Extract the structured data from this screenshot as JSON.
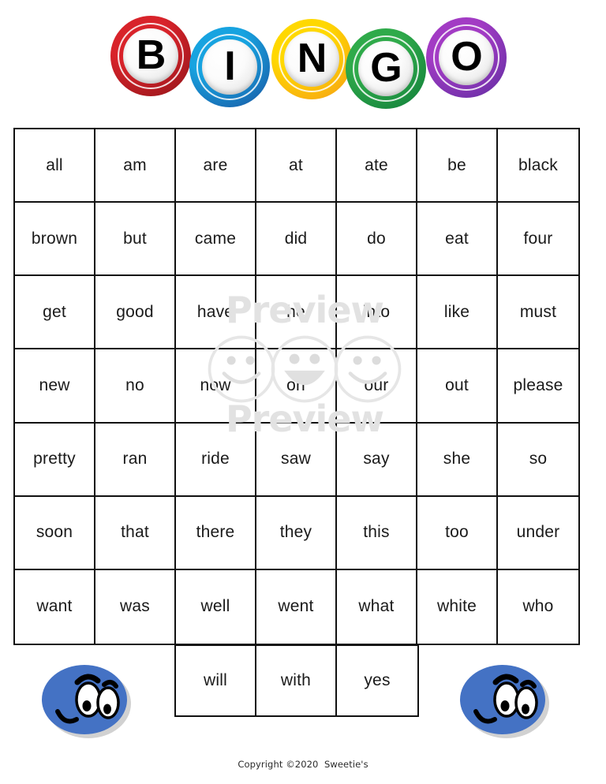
{
  "page": {
    "background_color": "#ffffff",
    "copyright": "Copyright ©2020  Sweetie's"
  },
  "header": {
    "title": "BINGO",
    "balls": [
      {
        "letter": "B",
        "color": "#d8232a",
        "dark": "#8c1419",
        "name": "bingo-ball-b"
      },
      {
        "letter": "I",
        "color": "#17a3e0",
        "dark": "#1a4f9c",
        "name": "bingo-ball-i"
      },
      {
        "letter": "N",
        "color": "#ffd800",
        "dark": "#f59a18",
        "name": "bingo-ball-n"
      },
      {
        "letter": "G",
        "color": "#2faa4a",
        "dark": "#0f7a3a",
        "name": "bingo-ball-g"
      },
      {
        "letter": "O",
        "color": "#a23bc4",
        "dark": "#5b2d9e",
        "name": "bingo-ball-o"
      }
    ]
  },
  "grid": {
    "columns": 7,
    "rows": 7,
    "words": [
      [
        "all",
        "am",
        "are",
        "at",
        "ate",
        "be",
        "black"
      ],
      [
        "brown",
        "but",
        "came",
        "did",
        "do",
        "eat",
        "four"
      ],
      [
        "get",
        "good",
        "have",
        "he",
        "into",
        "like",
        "must"
      ],
      [
        "new",
        "no",
        "now",
        "on",
        "our",
        "out",
        "please"
      ],
      [
        "pretty",
        "ran",
        "ride",
        "saw",
        "say",
        "she",
        "so"
      ],
      [
        "soon",
        "that",
        "there",
        "they",
        "this",
        "too",
        "under"
      ],
      [
        "want",
        "was",
        "well",
        "went",
        "what",
        "white",
        "who"
      ]
    ],
    "overflow_row": [
      "will",
      "with",
      "yes"
    ],
    "border_color": "#111111"
  },
  "watermark": {
    "text_top": "Preview",
    "text_bottom": "Preview",
    "color": "#e2e2e2",
    "smiley_count": 3
  },
  "mascots": [
    {
      "name": "mascot-face-left",
      "color": "#4472c4"
    },
    {
      "name": "mascot-face-right",
      "color": "#4472c4"
    }
  ]
}
